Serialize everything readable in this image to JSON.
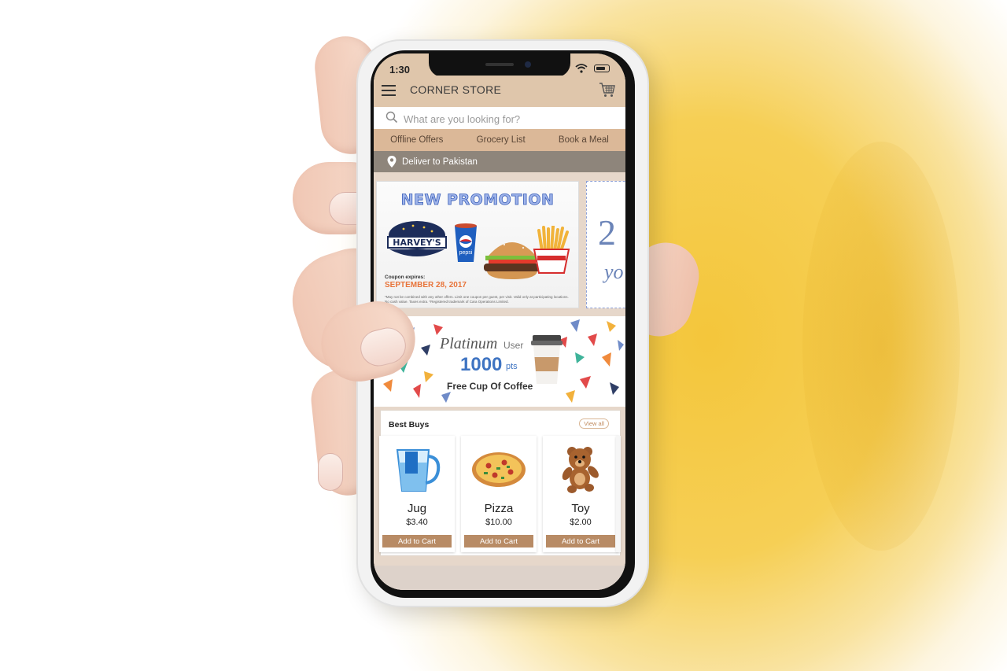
{
  "status_bar": {
    "time": "1:30"
  },
  "app": {
    "title": "CORNER STORE"
  },
  "search": {
    "placeholder": "What are you looking for?"
  },
  "tabs": [
    {
      "label": "Offline Offers"
    },
    {
      "label": "Grocery List"
    },
    {
      "label": "Book a Meal"
    }
  ],
  "delivery": {
    "label": "Deliver to Pakistan"
  },
  "promo": {
    "title": "NEW PROMOTION",
    "brand": "HARVEY'S",
    "cup_brand": "pepsi",
    "expires_label": "Coupon expires:",
    "expires_date": "SEPTEMBER 28, 2017",
    "fineprint": "*May not be combined with any other offers. Limit one coupon per guest, per visit. Valid only at participating locations. No cash value. Taxes extra. *Registered trademark of Cara Operations Limited."
  },
  "promo_next": {
    "number": "2",
    "text": "yo"
  },
  "platinum": {
    "label": "Platinum",
    "user": "User",
    "points": "1000",
    "points_unit": "pts",
    "offer": "Free Cup Of Coffee"
  },
  "best_buys": {
    "title": "Best Buys",
    "view_all": "View all",
    "add_label": "Add to Cart",
    "products": [
      {
        "name": "Jug",
        "price": "$3.40",
        "icon": "jug-icon"
      },
      {
        "name": "Pizza",
        "price": "$10.00",
        "icon": "pizza-icon"
      },
      {
        "name": "Toy",
        "price": "$2.00",
        "icon": "teddy-bear-icon"
      }
    ]
  },
  "colors": {
    "header": "#dfc6ab",
    "tab_bar": "#dbb898",
    "delivery_bar": "#8e857b",
    "button": "#b88b65",
    "points": "#3f74c2"
  }
}
